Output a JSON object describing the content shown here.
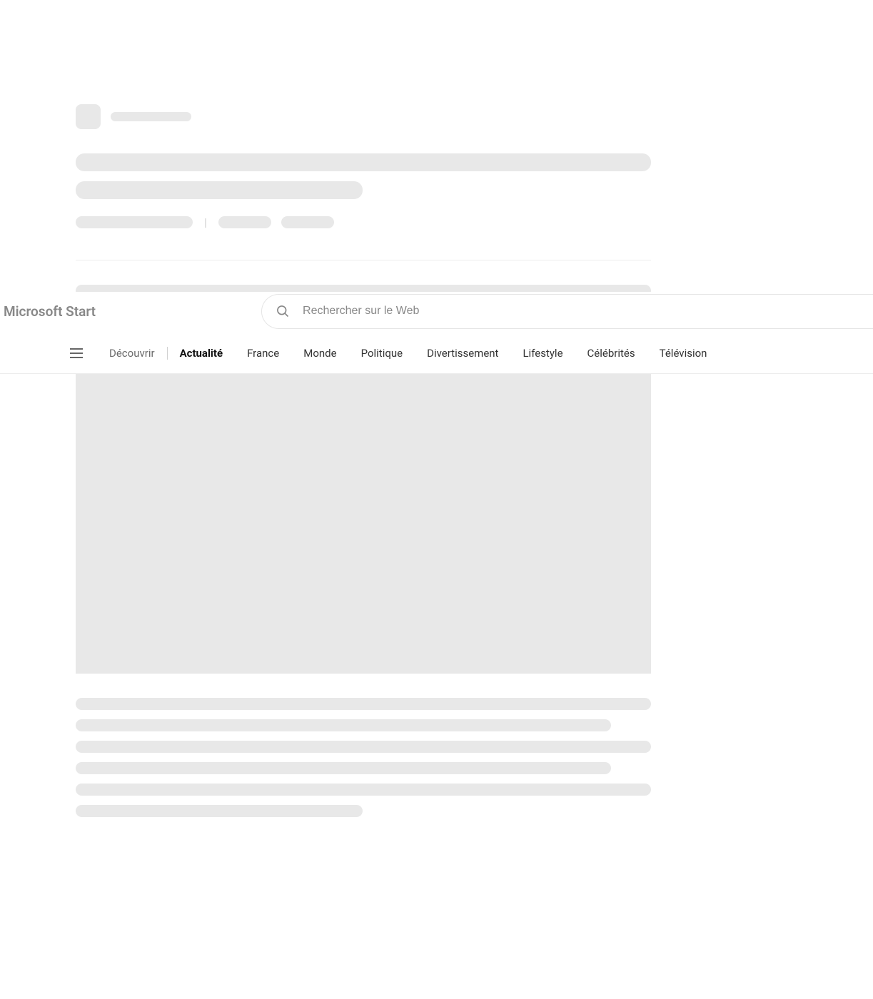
{
  "brand": {
    "name": "Microsoft Start"
  },
  "search": {
    "placeholder": "Rechercher sur le Web"
  },
  "nav": {
    "items": [
      {
        "label": "Découvrir",
        "type": "discover"
      },
      {
        "label": "Actualité",
        "type": "active"
      },
      {
        "label": "France",
        "type": "normal"
      },
      {
        "label": "Monde",
        "type": "normal"
      },
      {
        "label": "Politique",
        "type": "normal"
      },
      {
        "label": "Divertissement",
        "type": "normal"
      },
      {
        "label": "Lifestyle",
        "type": "normal"
      },
      {
        "label": "Célébrités",
        "type": "normal"
      },
      {
        "label": "Télévision",
        "type": "normal"
      }
    ]
  },
  "colors": {
    "skeleton": "#e8e8e8",
    "text_muted": "#888888",
    "text_default": "#333333",
    "border": "#ededed"
  }
}
